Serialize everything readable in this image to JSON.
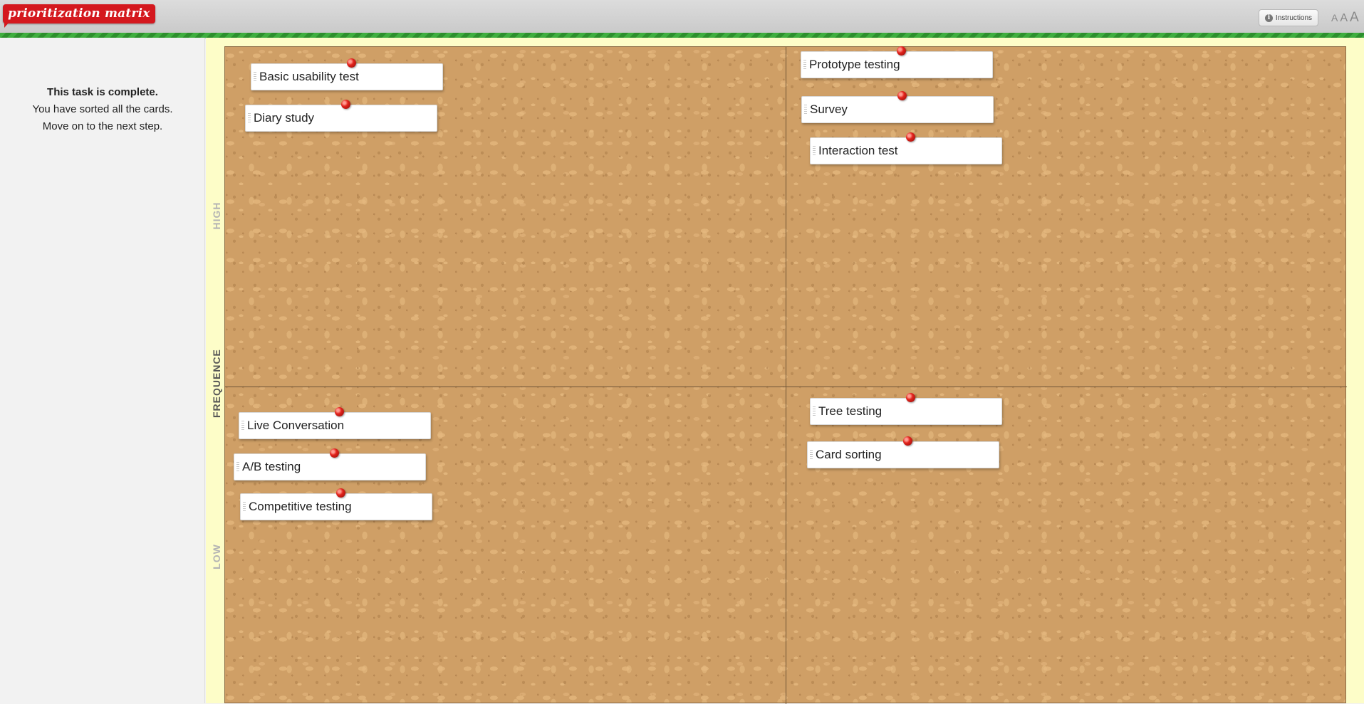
{
  "header": {
    "logo_text": "prioritization matrix",
    "instructions_label": "Instructions",
    "font_size_options": [
      "A",
      "A",
      "A"
    ]
  },
  "sidebar": {
    "status_title": "This task is complete.",
    "status_line1": "You have sorted all the cards.",
    "status_line2": "Move on to the next step."
  },
  "matrix": {
    "y_axis_label": "FREQUENCE",
    "y_axis_high": "HIGH",
    "y_axis_low": "LOW"
  },
  "quadrants": {
    "top_left": [
      "Basic usability test",
      "Diary study"
    ],
    "top_right": [
      "Prototype testing",
      "Survey",
      "Interaction test"
    ],
    "bottom_left": [
      "Live Conversation",
      "A/B testing",
      "Competitive testing"
    ],
    "bottom_right": [
      "Tree testing",
      "Card sorting"
    ]
  },
  "colors": {
    "logo_red": "#d4181e",
    "header_stripe_green": "#3fae3f",
    "axis_strip_yellow": "#fdfdc8",
    "cork": "#cf9f66",
    "pin_red": "#e3231c"
  }
}
